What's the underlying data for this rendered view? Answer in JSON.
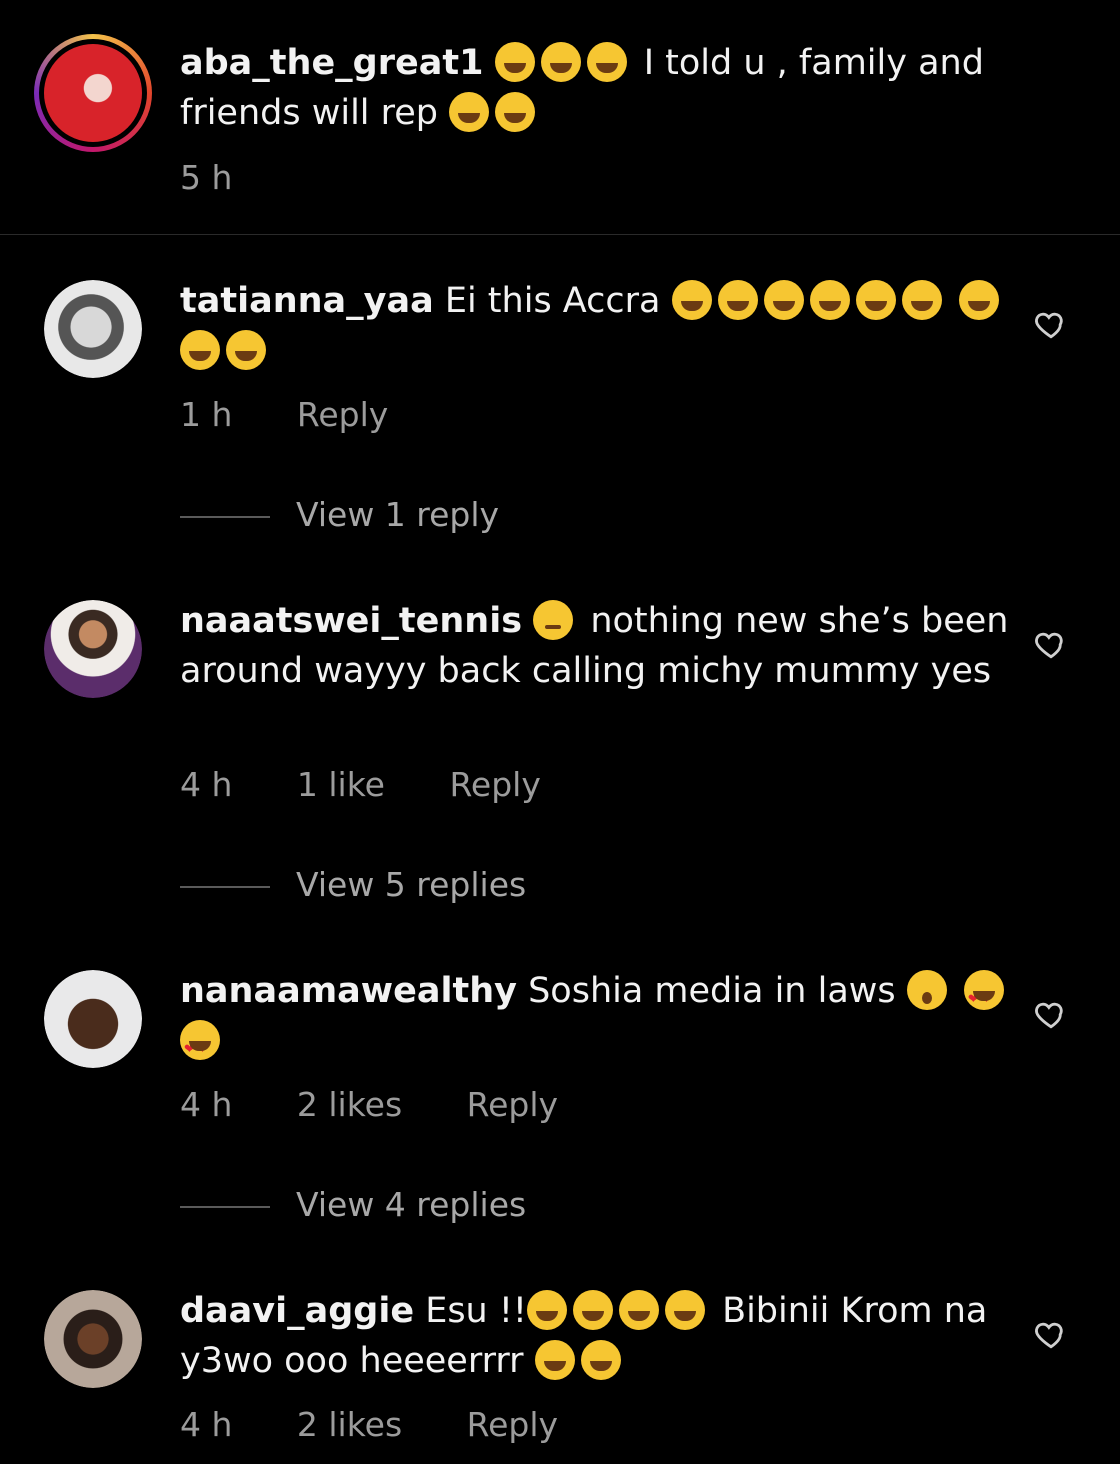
{
  "comments": [
    {
      "username": "aba_the_great1",
      "text_parts": [
        "",
        "I told u , family and friends will rep",
        ""
      ],
      "emoji_before": [
        "laugh",
        "laugh",
        "laugh"
      ],
      "emoji_after": [
        "rofl",
        "rofl"
      ],
      "time": "5 h"
    },
    {
      "username": "tatianna_yaa",
      "text": "Ei this Accra",
      "emojis": [
        "laugh",
        "laugh",
        "laugh",
        "laugh",
        "laugh",
        "laugh",
        "laugh",
        "laugh",
        "laugh"
      ],
      "time": "1 h",
      "reply_label": "Reply",
      "view_replies": "View 1 reply"
    },
    {
      "username": "naaatswei_tennis",
      "text": "nothing new she’s been around wayyy back calling michy mummy yes",
      "emojis": [
        "thinking"
      ],
      "time": "4 h",
      "likes": "1 like",
      "reply_label": "Reply",
      "view_replies": "View 5 replies"
    },
    {
      "username": "nanaamawealthy",
      "text": "Soshia media in laws",
      "emojis": [
        "astonished",
        "heart-eyes",
        "heart-eyes"
      ],
      "time": "4 h",
      "likes": "2 likes",
      "reply_label": "Reply",
      "view_replies": "View 4 replies"
    },
    {
      "username": "daavi_aggie",
      "text_a": "Esu !!",
      "text_b": "Bibinii Krom na y3wo ooo heeeerrrr",
      "emojis": [
        "laugh",
        "laugh",
        "laugh",
        "laugh",
        "rofl",
        "rofl"
      ],
      "time": "4 h",
      "likes": "2 likes",
      "reply_label": "Reply"
    }
  ],
  "colors": {
    "background": "#000000",
    "text": "#f2f2f2",
    "meta": "#9c9c9c",
    "emoji": "#f6c632"
  },
  "icons": {
    "like": "heart-outline-icon"
  }
}
